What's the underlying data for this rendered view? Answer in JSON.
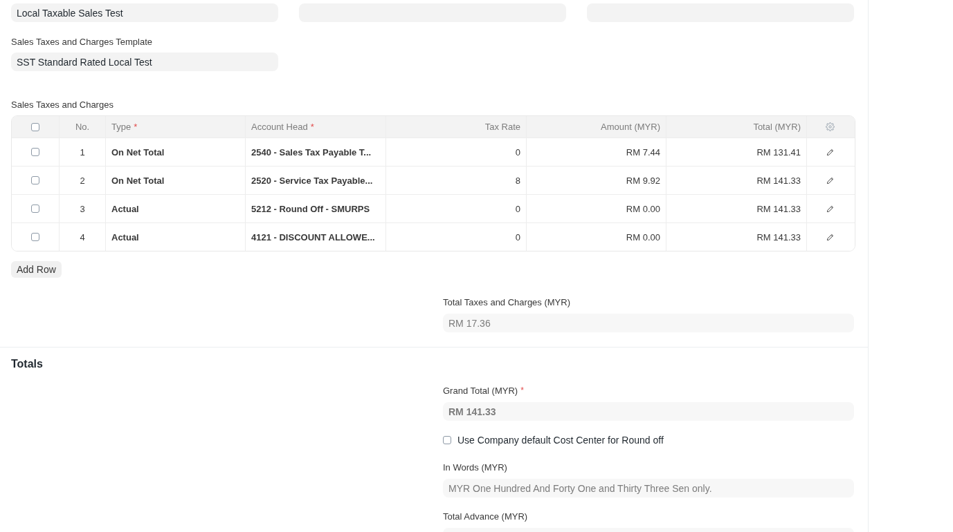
{
  "top_fields": [
    {
      "kind": "filled",
      "value": "Local Taxable Sales Test"
    },
    {
      "kind": "empty"
    },
    {
      "kind": "empty"
    }
  ],
  "template": {
    "label": "Sales Taxes and Charges Template",
    "value": "SST Standard Rated Local Test"
  },
  "taxes": {
    "label": "Sales Taxes and Charges",
    "select_all_checked": false,
    "columns": [
      {
        "label": "No."
      },
      {
        "label": "Type",
        "required_mark": "*"
      },
      {
        "label": "Account Head",
        "required_mark": "*"
      },
      {
        "label": "Tax Rate"
      },
      {
        "label": "Amount (MYR)"
      },
      {
        "label": "Total (MYR)"
      }
    ],
    "rows": [
      {
        "checked": false,
        "cells": [
          "1",
          "On Net Total",
          "2540 - Sales Tax Payable T...",
          "0",
          "RM 7.44",
          "RM 131.41"
        ]
      },
      {
        "checked": false,
        "cells": [
          "2",
          "On Net Total",
          "2520 - Service Tax Payable...",
          "8",
          "RM 9.92",
          "RM 141.33"
        ]
      },
      {
        "checked": false,
        "cells": [
          "3",
          "Actual",
          "5212 - Round Off - SMURPS",
          "0",
          "RM 0.00",
          "RM 141.33"
        ]
      },
      {
        "checked": false,
        "cells": [
          "4",
          "Actual",
          "4121 - DISCOUNT ALLOWE...",
          "0",
          "RM 0.00",
          "RM 141.33"
        ]
      }
    ],
    "add_row": "Add Row"
  },
  "total_taxes": {
    "label": "Total Taxes and Charges (MYR)",
    "value": "RM 17.36"
  },
  "totals": {
    "heading": "Totals",
    "grand_total": {
      "label": "Grand Total (MYR)",
      "required_mark": "*",
      "value": "RM 141.33"
    },
    "round_off_checkbox": {
      "label": "Use Company default Cost Center for Round off",
      "checked": false
    },
    "in_words": {
      "label": "In Words (MYR)",
      "value": "MYR One Hundred And Forty One and Thirty Three Sen only."
    },
    "total_advance": {
      "label": "Total Advance (MYR)"
    }
  }
}
